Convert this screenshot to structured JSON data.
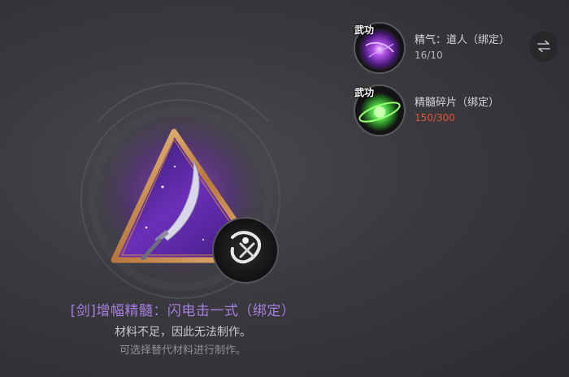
{
  "item": {
    "title": "[剑]增幅精髓：闪电击一式（绑定）",
    "warning": "材料不足，因此无法制作。",
    "hint": "可选择替代材料进行制作。"
  },
  "materials": [
    {
      "badge": "武功",
      "name": "精气：道人（绑定）",
      "count": "16/10",
      "sufficient": true,
      "icon": "purple-orb-icon"
    },
    {
      "badge": "武功",
      "name": "精髓碎片（绑定）",
      "count": "150/300",
      "sufficient": false,
      "icon": "green-orb-icon"
    }
  ],
  "swap_icon": "swap-arrows-icon",
  "colors": {
    "title": "#a57ee0",
    "shortage": "#e0533c"
  }
}
